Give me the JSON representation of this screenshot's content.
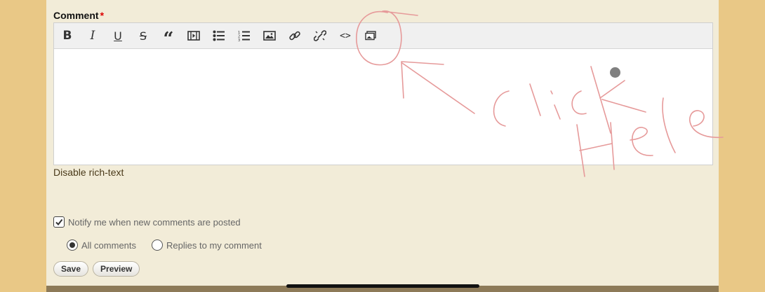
{
  "form": {
    "comment_label": "Comment",
    "required_marker": "*",
    "disable_rich_text": "Disable rich-text",
    "notify_label": "Notify me when new comments are posted",
    "notify_checked": true,
    "radio_options": [
      {
        "label": "All comments",
        "selected": true
      },
      {
        "label": "Replies to my comment",
        "selected": false
      }
    ],
    "save_label": "Save",
    "preview_label": "Preview"
  },
  "toolbar": {
    "buttons": [
      {
        "icon": "bold-icon",
        "glyph": "B"
      },
      {
        "icon": "italic-icon",
        "glyph": "I"
      },
      {
        "icon": "underline-icon",
        "glyph": "U"
      },
      {
        "icon": "strikethrough-icon",
        "glyph": "S"
      },
      {
        "icon": "blockquote-icon",
        "glyph": "“"
      },
      {
        "icon": "video-icon",
        "glyph": ""
      },
      {
        "icon": "bulleted-list-icon",
        "glyph": ""
      },
      {
        "icon": "numbered-list-icon",
        "glyph": ""
      },
      {
        "icon": "image-icon",
        "glyph": ""
      },
      {
        "icon": "link-icon",
        "glyph": ""
      },
      {
        "icon": "unlink-icon",
        "glyph": ""
      },
      {
        "icon": "source-code-icon",
        "glyph": "<>"
      },
      {
        "icon": "media-embed-icon",
        "glyph": ""
      }
    ]
  },
  "colors": {
    "page_background": "#e9c886",
    "panel_background": "#f2ecd8",
    "required": "#dd0000",
    "annotation": "#e07a7a"
  }
}
